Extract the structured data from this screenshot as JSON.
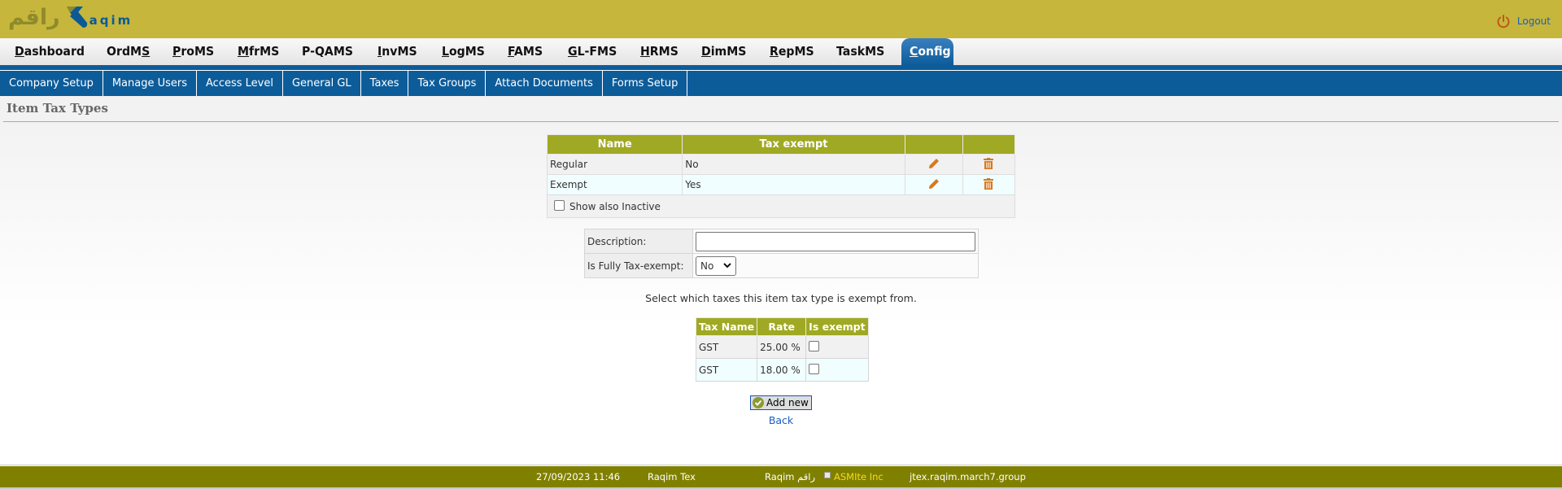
{
  "header": {
    "logo_arabic": "راقم",
    "logo_text": "aqim",
    "logout_label": "Logout"
  },
  "main_nav": [
    {
      "label_u": "D",
      "label_rest": "ashboard",
      "label_pre": ""
    },
    {
      "label_pre": "OrdM",
      "label_u": "S",
      "label_rest": ""
    },
    {
      "label_pre": "",
      "label_u": "P",
      "label_rest": "roMS"
    },
    {
      "label_pre": "",
      "label_u": "M",
      "label_rest": "frMS"
    },
    {
      "label_pre": "P-QAMS",
      "label_u": "",
      "label_rest": ""
    },
    {
      "label_pre": "",
      "label_u": "I",
      "label_rest": "nvMS"
    },
    {
      "label_pre": "",
      "label_u": "L",
      "label_rest": "ogMS"
    },
    {
      "label_pre": "",
      "label_u": "F",
      "label_rest": "AMS"
    },
    {
      "label_pre": "",
      "label_u": "G",
      "label_rest": "L-FMS"
    },
    {
      "label_pre": "",
      "label_u": "H",
      "label_rest": "RMS"
    },
    {
      "label_pre": "",
      "label_u": "D",
      "label_rest": "imMS"
    },
    {
      "label_pre": "",
      "label_u": "R",
      "label_rest": "epMS"
    },
    {
      "label_pre": "TaskMS",
      "label_u": "",
      "label_rest": ""
    }
  ],
  "active_nav": {
    "label_u": "C",
    "label_rest": "onfig"
  },
  "sub_nav": [
    "Company Setup",
    "Manage Users",
    "Access Level",
    "General GL",
    "Taxes",
    "Tax Groups",
    "Attach Documents",
    "Forms Setup"
  ],
  "page_title": "Item Tax Types",
  "list": {
    "headers": [
      "Name",
      "Tax exempt",
      "",
      ""
    ],
    "rows": [
      {
        "name": "Regular",
        "tax_exempt": "No",
        "edit_icon": "pencil-icon",
        "delete_icon": "trash-icon"
      },
      {
        "name": "Exempt",
        "tax_exempt": "Yes",
        "edit_icon": "pencil-icon",
        "delete_icon": "trash-icon"
      }
    ],
    "show_inactive_label": "Show also Inactive",
    "show_inactive_checked": false
  },
  "form": {
    "description_label": "Description:",
    "description_value": "",
    "fully_exempt_label": "Is Fully Tax-exempt:",
    "fully_exempt_value": "No"
  },
  "hint": "Select which taxes this item tax type is exempt from.",
  "taxes": {
    "headers": [
      "Tax Name",
      "Rate",
      "Is exempt"
    ],
    "rows": [
      {
        "name": "GST",
        "rate": "25.00 %",
        "exempt": false
      },
      {
        "name": "GST",
        "rate": "18.00 %",
        "exempt": false
      }
    ]
  },
  "buttons": {
    "add_new": "Add new",
    "back": "Back"
  },
  "footer": {
    "datetime": "27/09/2023 11:46",
    "company": "Raqim Tex",
    "app": "Raqim راقم",
    "vendor": "ASMIte Inc",
    "host": "jtex.raqim.march7.group"
  },
  "colors": {
    "topbar": "#c6b63c",
    "nav_blue": "#0d5c9a",
    "table_header": "#a0a923",
    "footer": "#808000",
    "icon_orange": "#d9781a",
    "link_blue": "#1a5fc0"
  }
}
